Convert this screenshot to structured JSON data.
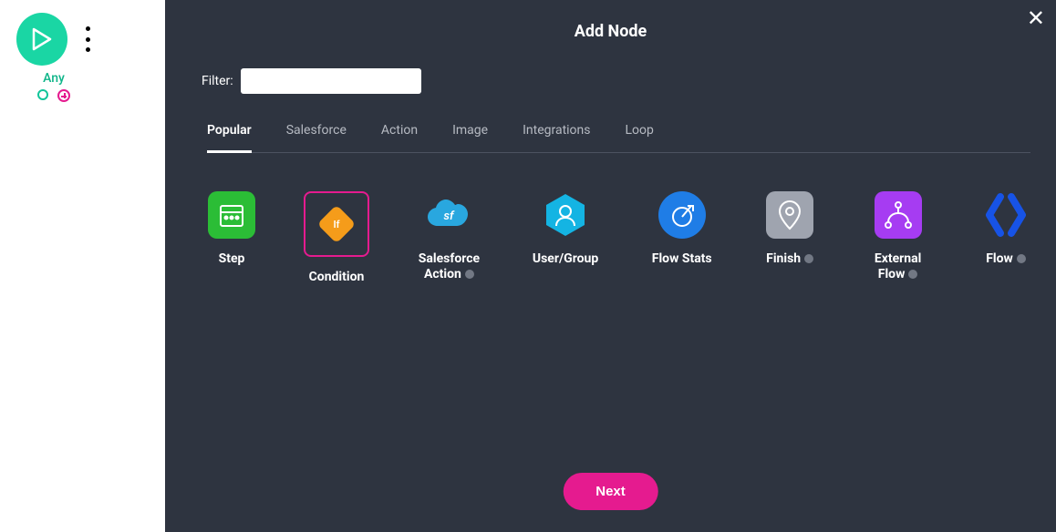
{
  "canvas": {
    "node_label": "Any"
  },
  "modal": {
    "title": "Add Node",
    "filter_label": "Filter:",
    "filter_value": "",
    "tabs": [
      {
        "label": "Popular",
        "active": true
      },
      {
        "label": "Salesforce",
        "active": false
      },
      {
        "label": "Action",
        "active": false
      },
      {
        "label": "Image",
        "active": false
      },
      {
        "label": "Integrations",
        "active": false
      },
      {
        "label": "Loop",
        "active": false
      }
    ],
    "tiles": [
      {
        "id": "step",
        "label": "Step",
        "has_info": false
      },
      {
        "id": "condition",
        "label": "Condition",
        "has_info": false,
        "selected": true
      },
      {
        "id": "salesforce-action",
        "label": "Salesforce Action",
        "has_info": true
      },
      {
        "id": "user-group",
        "label": "User/Group",
        "has_info": false
      },
      {
        "id": "flow-stats",
        "label": "Flow Stats",
        "has_info": false
      },
      {
        "id": "finish",
        "label": "Finish",
        "has_info": true
      },
      {
        "id": "external-flow",
        "label": "External Flow",
        "has_info": true
      },
      {
        "id": "flow",
        "label": "Flow",
        "has_info": true
      }
    ],
    "next_label": "Next"
  },
  "colors": {
    "accent_pink": "#e51b8f",
    "accent_teal": "#1ad6a4",
    "modal_bg": "#2e3440"
  }
}
